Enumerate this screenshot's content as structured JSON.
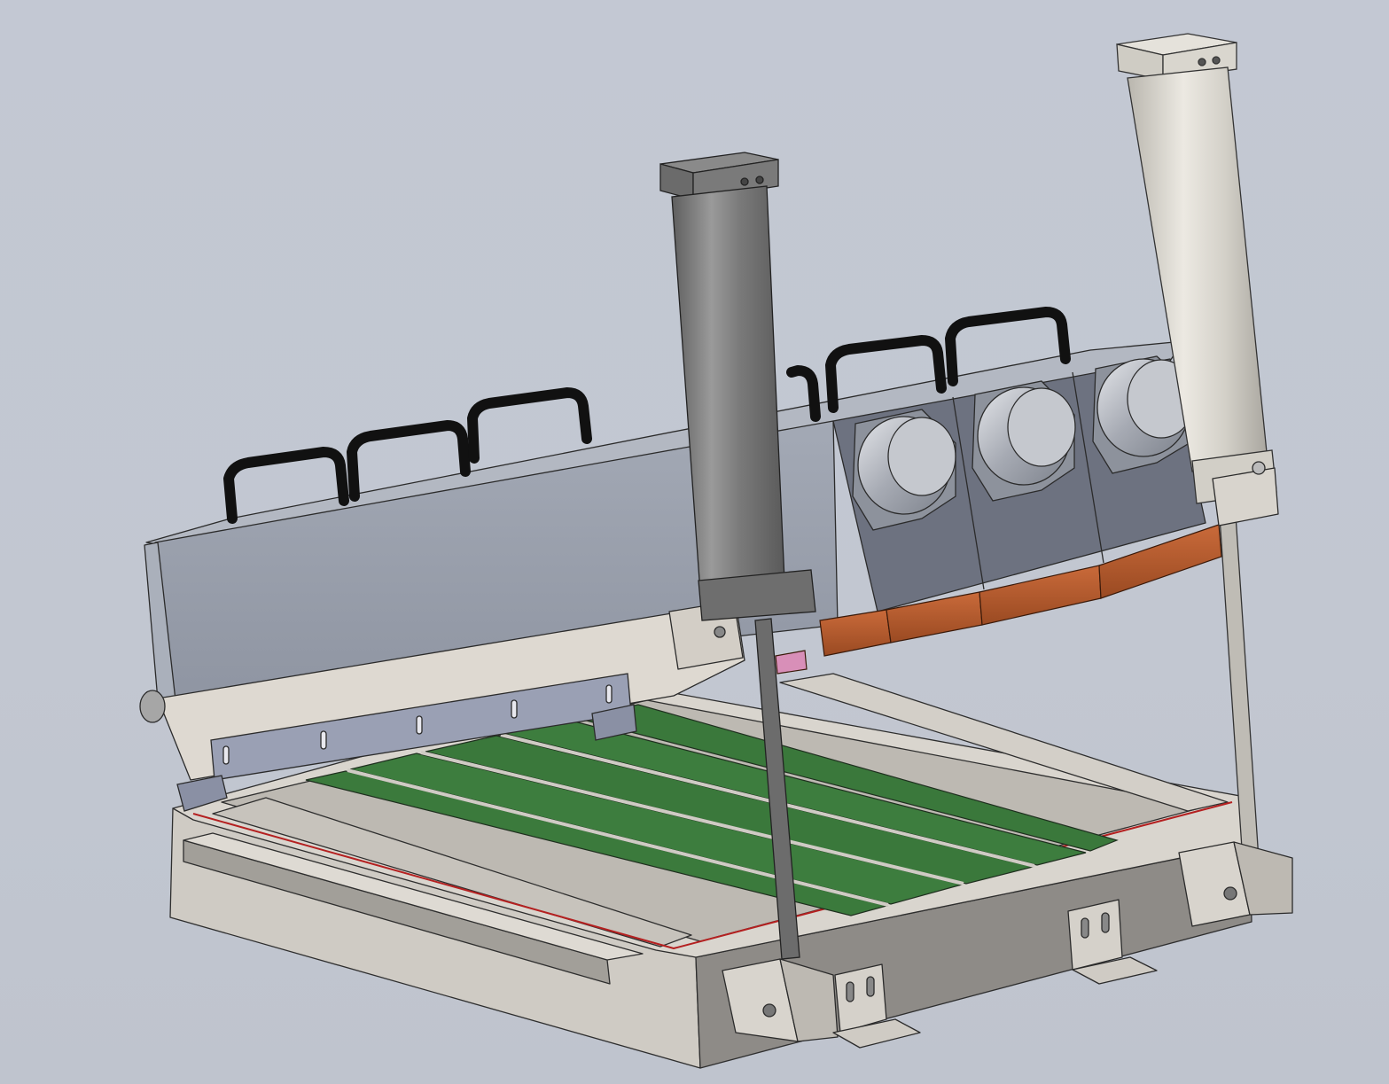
{
  "scene": {
    "background_color": "#c2c7d1",
    "colors": {
      "base_frame": "#cfcbc4",
      "base_frame_shadow": "#8e8b87",
      "green_panels": "#3b7a3c",
      "housing": "#9399a6",
      "housing_dark": "#6d7280",
      "handles": "#111111",
      "cylinder_dark": "#777777",
      "cylinder_light": "#d8d5ce",
      "copper_blocks": "#b85a2c",
      "squeegee_bar": "#9aa0b4"
    },
    "icons": [
      "base-frame",
      "green-panel",
      "upper-housing",
      "handle",
      "nozzle-port",
      "air-cylinder",
      "copper-block",
      "mounting-bracket",
      "squeegee-bar"
    ]
  }
}
